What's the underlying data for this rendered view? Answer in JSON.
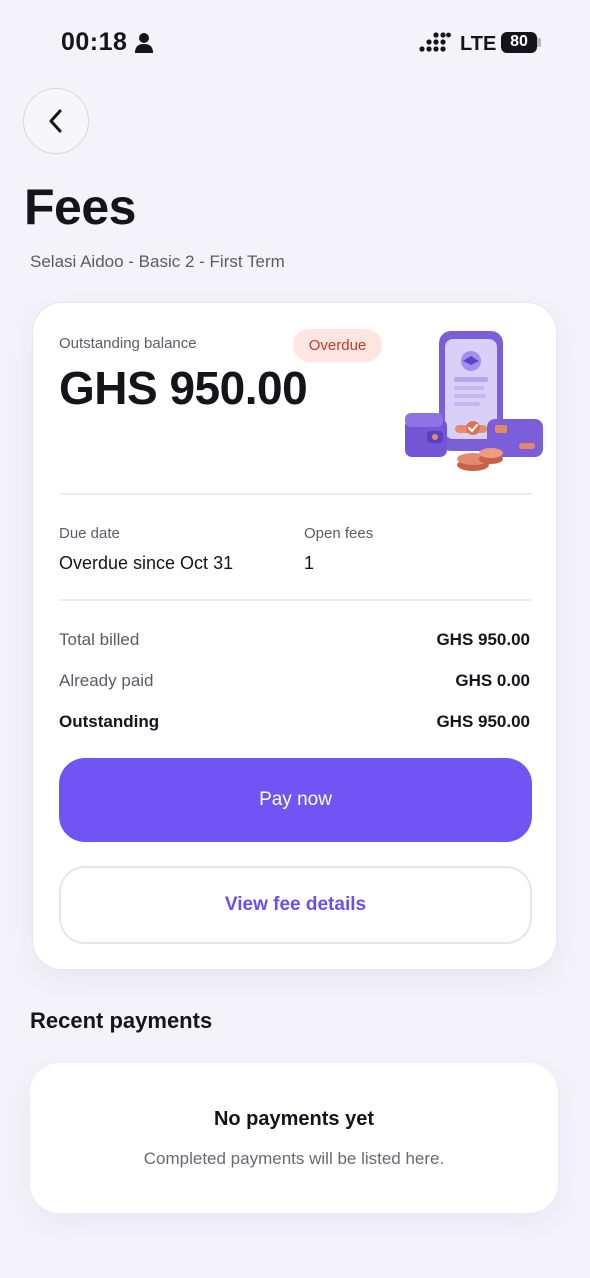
{
  "status_bar": {
    "time": "00:18",
    "network": "LTE",
    "battery": "80"
  },
  "header": {
    "back_icon": "chevron-left-icon",
    "title": "Fees",
    "subtitle": "Selasi Aidoo - Basic 2 - First Term"
  },
  "balance_card": {
    "outstanding_label": "Outstanding balance",
    "amount": "GHS 950.00",
    "status_badge": "Overdue",
    "illustration": "phone-wallet-coins-icon",
    "due_date_label": "Due date",
    "due_date_value": "Overdue since Oct 31",
    "open_fees_label": "Open fees",
    "open_fees_value": "1",
    "rows": [
      {
        "label": "Total billed",
        "value": "GHS 950.00"
      },
      {
        "label": "Already paid",
        "value": "GHS 0.00"
      },
      {
        "label": "Outstanding",
        "value": "GHS 950.00"
      }
    ],
    "pay_button": "Pay now",
    "details_button": "View fee details"
  },
  "recent_payments": {
    "title": "Recent payments",
    "empty_title": "No payments yet",
    "empty_subtitle": "Completed payments will be listed here."
  },
  "colors": {
    "accent": "#7055f4",
    "badge_bg": "#fde6e2",
    "badge_text": "#c23b2c",
    "background": "#f4f3fa"
  }
}
